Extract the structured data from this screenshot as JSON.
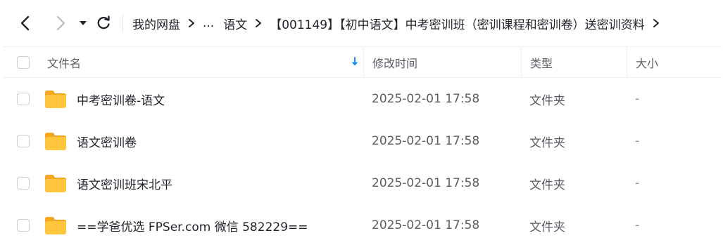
{
  "toolbar": {
    "back_icon": "chevron-left-icon",
    "forward_icon": "chevron-right-icon",
    "dropdown_icon": "triangle-down-icon",
    "refresh_icon": "refresh-icon"
  },
  "breadcrumb": {
    "items": [
      "我的网盘",
      "...",
      "语文",
      "【001149】【初中语文】中考密训班（密训课程和密训卷）送密训资料"
    ]
  },
  "table": {
    "columns": {
      "name": "文件名",
      "time": "修改时间",
      "type": "类型",
      "size": "大小"
    },
    "sort_icon": "sort-down-arrow-icon",
    "rows": [
      {
        "name": "中考密训卷-语文",
        "time": "2025-02-01 17:58",
        "type": "文件夹",
        "size": "-"
      },
      {
        "name": "语文密训卷",
        "time": "2025-02-01 17:58",
        "type": "文件夹",
        "size": "-"
      },
      {
        "name": "语文密训班宋北平",
        "time": "2025-02-01 17:58",
        "type": "文件夹",
        "size": "-"
      },
      {
        "name": "==学爸优选 FPSer.com 微信 582229==",
        "time": "2025-02-01 17:58",
        "type": "文件夹",
        "size": "-"
      }
    ]
  },
  "colors": {
    "folder": "#ffc53d",
    "accent": "#1e8bf0",
    "text": "#1f2329",
    "muted": "#5a5f66"
  }
}
